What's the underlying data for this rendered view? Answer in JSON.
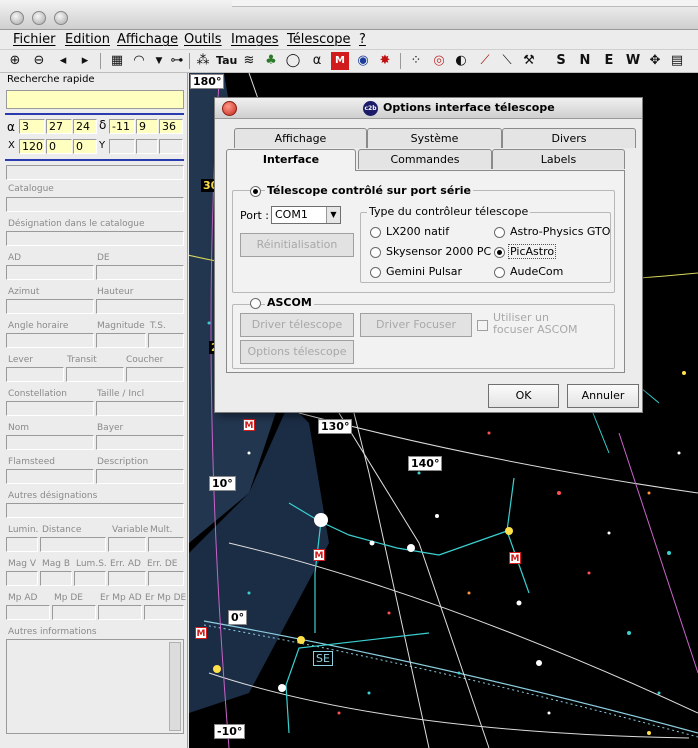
{
  "menu": [
    "Fichier",
    "Edition",
    "Affichage",
    "Outils",
    "Images",
    "Télescope",
    "?"
  ],
  "toolbar_letters": [
    "S",
    "N",
    "E",
    "W"
  ],
  "toolbar_red": "M",
  "left": {
    "search_label": "Recherche rapide",
    "alpha_symbol": "α",
    "alpha": [
      "3",
      "27",
      "24"
    ],
    "delta_symbol": "δ",
    "delta": [
      "-11",
      "9",
      "36"
    ],
    "x_label": "X",
    "x": [
      "120",
      "0",
      "0"
    ],
    "y_label": "Y",
    "labels": {
      "catalogue": "Catalogue",
      "designation": "Désignation dans le catalogue",
      "ad": "AD",
      "de": "DE",
      "azimut": "Azimut",
      "hauteur": "Hauteur",
      "angle_horaire": "Angle horaire",
      "magnitude": "Magnitude",
      "ts": "T.S.",
      "lever": "Lever",
      "transit": "Transit",
      "coucher": "Coucher",
      "constellation": "Constellation",
      "taille": "Taille / Incl",
      "nom": "Nom",
      "bayer": "Bayer",
      "flamsteed": "Flamsteed",
      "description": "Description",
      "autres_designations": "Autres désignations",
      "lumin": "Lumin.",
      "distance": "Distance",
      "variable": "Variable",
      "mult": "Mult.",
      "magv": "Mag V",
      "magb": "Mag B",
      "lums": "Lum.S.",
      "errad": "Err. AD",
      "errde": "Err. DE",
      "mpad": "Mp AD",
      "mpde": "Mp DE",
      "errmpad": "Er Mp AD",
      "errmpde": "Er Mp DE",
      "autres_infos": "Autres informations"
    }
  },
  "sky": {
    "degree_labels": [
      "180°",
      "130°",
      "140°",
      "10°",
      "0°",
      "-10°",
      "30",
      "2"
    ],
    "se_label": "SE"
  },
  "dialog": {
    "icon_text": "c2b",
    "title": "Options interface télescope",
    "tabs_back": [
      "Affichage",
      "Système",
      "Divers"
    ],
    "tabs_front": [
      "Interface",
      "Commandes",
      "Labels"
    ],
    "serial_radio": "Télescope contrôlé sur port série",
    "port_label": "Port :",
    "port_value": "COM1",
    "reinit_button": "Réinitialisation",
    "controller_group": "Type du contrôleur télescope",
    "controllers": [
      "LX200 natif",
      "Astro-Physics GTO",
      "Skysensor 2000 PC",
      "PicAstro",
      "Gemini Pulsar",
      "AudeCom"
    ],
    "selected_controller": "PicAstro",
    "ascom_radio": "ASCOM",
    "ascom_buttons": [
      "Driver télescope",
      "Driver Focuser",
      "Options télescope"
    ],
    "focuser_check": "Utiliser un focuser ASCOM",
    "ok": "OK",
    "cancel": "Annuler"
  }
}
